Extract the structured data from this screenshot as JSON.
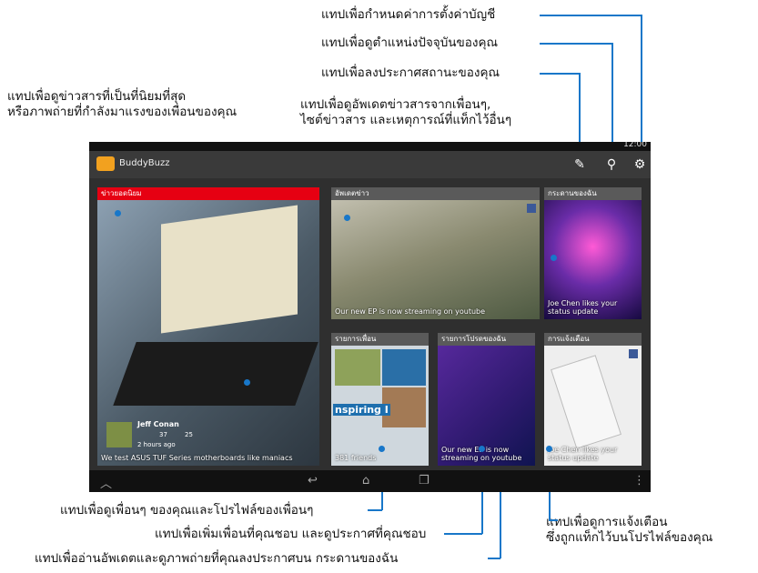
{
  "callouts": {
    "account_settings": "แทปเพื่อกำหนดค่าการตั้งค่าบัญชี",
    "location": "แทปเพื่อดูตำแหน่งปัจจุบันของคุณ",
    "post_status": "แทปเพื่อลงประกาศสถานะของคุณ",
    "popular_line1": "แทปเพื่อดูข่าวสารที่เป็นที่นิยมที่สุด",
    "popular_line2": "หรือภาพถ่ายที่กำลังมาแรงของเพื่อนของคุณ",
    "updates_line1": "แทปเพื่อดูอัพเดตข่าวสารจากเพื่อนๆ,",
    "updates_line2": "ไซต์ข่าวสาร และเหตุการณ์ที่แท็กไว้อื่นๆ",
    "friends_list": "แทปเพื่อดูเพื่อนๆ ของคุณและโปรไฟล์ของเพื่อนๆ",
    "favorites": "แทปเพื่อเพิ่มเพื่อนที่คุณชอบ และดูประกาศที่คุณชอบ",
    "my_board": "แทปเพื่ออ่านอัพเดตและดูภาพถ่ายที่คุณลงประกาศบน กระดานของฉัน",
    "notif_line1": "แทปเพื่อดูการแจ้งเตือน",
    "notif_line2": "ซึ่งถูกแท็กไว้บนโปรไฟล์ของคุณ"
  },
  "device": {
    "time": "12:00",
    "app_title": "BuddyBuzz",
    "tiles": {
      "popular": {
        "header": "ข่าวยอดนิยม",
        "user": "Jeff Conan",
        "likes": "37",
        "comments": "25",
        "time": "2 hours ago",
        "caption": "We test ASUS TUF Series motherboards like maniacs"
      },
      "updates": {
        "header": "อัพเดตข่าว",
        "caption": "Our new EP is now streaming on youtube"
      },
      "board": {
        "header": "กระดานของฉัน",
        "caption": "Joe Chen likes your status update"
      },
      "friends": {
        "header": "รายการเพื่อน",
        "count": "381 friends",
        "banner": "nspiring I"
      },
      "favorites": {
        "header": "รายการโปรดของฉัน",
        "caption": "Our new EP is now streaming on youtube"
      },
      "notifications": {
        "header": "การแจ้งเตือน",
        "caption": "Joe Chen likes your status update"
      }
    }
  }
}
